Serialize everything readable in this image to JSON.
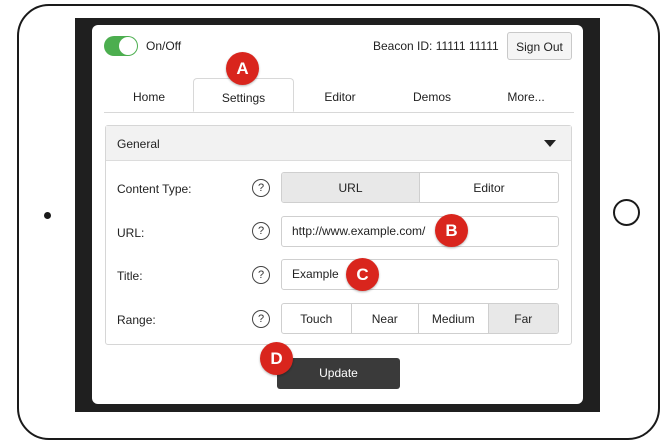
{
  "header": {
    "toggle_label": "On/Off",
    "toggle_on": true,
    "beacon_id": "Beacon ID: 11111 11111",
    "signout_label": "Sign Out"
  },
  "tabs": [
    {
      "label": "Home",
      "active": false
    },
    {
      "label": "Settings",
      "active": true
    },
    {
      "label": "Editor",
      "active": false
    },
    {
      "label": "Demos",
      "active": false
    },
    {
      "label": "More...",
      "active": false
    }
  ],
  "panel": {
    "title": "General",
    "rows": {
      "content_type": {
        "label": "Content Type:",
        "options": [
          "URL",
          "Editor"
        ],
        "selected": "URL"
      },
      "url": {
        "label": "URL:",
        "value": "http://www.example.com/"
      },
      "title": {
        "label": "Title:",
        "value": "Example"
      },
      "range": {
        "label": "Range:",
        "options": [
          "Touch",
          "Near",
          "Medium",
          "Far"
        ],
        "selected": "Far"
      }
    },
    "help_glyph": "?"
  },
  "update_label": "Update",
  "callouts": {
    "a": "A",
    "b": "B",
    "c": "C",
    "d": "D"
  },
  "colors": {
    "toggle_green": "#4cae4f",
    "callout_red": "#d9251d",
    "button_dark": "#3a3a3a"
  }
}
